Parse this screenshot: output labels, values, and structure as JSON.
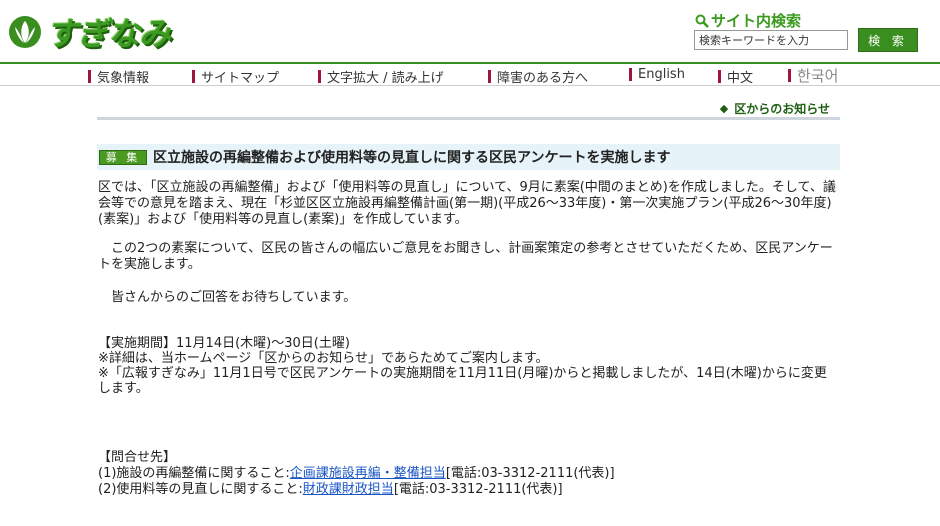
{
  "header": {
    "logo_text": "すぎなみ",
    "search_title": "サイト内検索",
    "search_placeholder": "検索キーワードを入力",
    "search_button": "検 索"
  },
  "nav": {
    "items": [
      {
        "label": "気象情報"
      },
      {
        "label": "サイトマップ"
      },
      {
        "label": "文字拡大 / 読み上げ"
      },
      {
        "label": "障害のある方へ"
      },
      {
        "label": "English"
      },
      {
        "label": "中文"
      },
      {
        "label": "한국어"
      }
    ]
  },
  "section": {
    "link_label": "区からのお知らせ"
  },
  "article": {
    "badge": "募 集",
    "title": "区立施設の再編整備および使用料等の見直しに関する区民アンケートを実施します",
    "para1": "区では、「区立施設の再編整備」および「使用料等の見直し」について、9月に素案(中間のまとめ)を作成しました。そして、議会等での意見を踏まえ、現在「杉並区区立施設再編整備計画(第一期)(平成26～33年度)・第一次実施プラン(平成26～30年度)(素案)」および「使用料等の見直し(素案)」を作成しています。",
    "para2": "　この2つの素案について、区民の皆さんの幅広いご意見をお聞きし、計画案策定の参考とさせていただくため、区民アンケートを実施します。",
    "para3": "　皆さんからのご回答をお待ちしています。",
    "period": "【実施期間】11月14日(木曜)～30日(土曜)",
    "note1": "※詳細は、当ホームページ「区からのお知らせ」であらためてご案内します。",
    "note2": "※「広報すぎなみ」11月1日号で区民アンケートの実施期間を11月11日(月曜)からと掲載しましたが、14日(木曜)からに変更します。",
    "contact_heading": "【問合せ先】",
    "contact1_prefix": "(1)施設の再編整備に関すること:",
    "contact1_link": "企画課施設再編・整備担当",
    "contact1_suffix": "[電話:03-3312-2111(代表)]",
    "contact2_prefix": "(2)使用料等の見直しに関すること:",
    "contact2_link": "財政課財政担当",
    "contact2_suffix": "[電話:03-3312-2111(代表)]"
  },
  "colors": {
    "brand_green": "#3a8e1f",
    "nav_bar": "#a0143c",
    "title_bg": "#e6f3f8",
    "link_blue": "#1a56c6"
  }
}
